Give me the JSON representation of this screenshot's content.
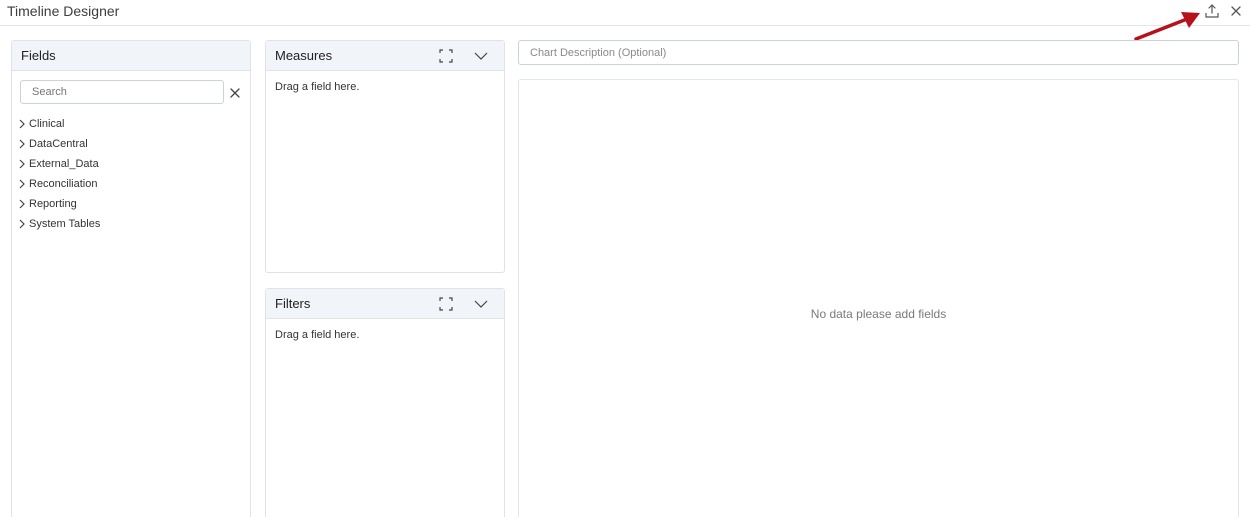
{
  "window": {
    "title": "Timeline Designer",
    "actions": [
      {
        "icon": "export-upload-icon"
      },
      {
        "icon": "close-icon"
      }
    ]
  },
  "fields_panel": {
    "title": "Fields",
    "search": {
      "placeholder": "Search",
      "value": ""
    },
    "tree": [
      {
        "label": "Clinical"
      },
      {
        "label": "DataCentral"
      },
      {
        "label": "External_Data"
      },
      {
        "label": "Reconciliation"
      },
      {
        "label": "Reporting"
      },
      {
        "label": "System Tables"
      }
    ]
  },
  "measures_panel": {
    "title": "Measures",
    "hint": "Drag a field here."
  },
  "filters_panel": {
    "title": "Filters",
    "hint": "Drag a field here."
  },
  "chart": {
    "description": {
      "placeholder": "Chart Description (Optional)",
      "value": ""
    },
    "empty_message": "No data please add fields"
  },
  "colors": {
    "annotation_arrow": "#b5121b",
    "panel_header_bg": "#f1f4f8",
    "border": "#dfe3e8"
  }
}
